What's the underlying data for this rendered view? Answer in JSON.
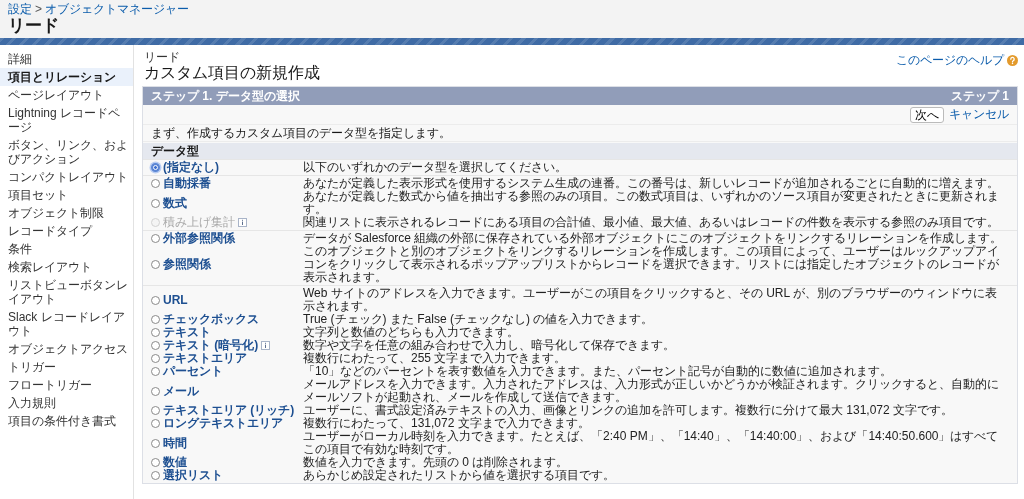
{
  "header": {
    "breadcrumb": [
      "設定",
      "オブジェクトマネージャー"
    ],
    "separator": ">",
    "title": "リード"
  },
  "sidebar": {
    "items": [
      {
        "label": "詳細",
        "selected": false
      },
      {
        "label": "項目とリレーション",
        "selected": true
      },
      {
        "label": "ページレイアウト",
        "selected": false
      },
      {
        "label": "Lightning レコードページ",
        "selected": false
      },
      {
        "label": "ボタン、リンク、およびアクション",
        "selected": false
      },
      {
        "label": "コンパクトレイアウト",
        "selected": false
      },
      {
        "label": "項目セット",
        "selected": false
      },
      {
        "label": "オブジェクト制限",
        "selected": false
      },
      {
        "label": "レコードタイプ",
        "selected": false
      },
      {
        "label": "条件",
        "selected": false
      },
      {
        "label": "検索レイアウト",
        "selected": false
      },
      {
        "label": "リストビューボタンレイアウト",
        "selected": false
      },
      {
        "label": "Slack レコードレイアウト",
        "selected": false
      },
      {
        "label": "オブジェクトアクセス",
        "selected": false
      },
      {
        "label": "トリガー",
        "selected": false
      },
      {
        "label": "フロートリガー",
        "selected": false
      },
      {
        "label": "入力規則",
        "selected": false
      },
      {
        "label": "項目の条件付き書式",
        "selected": false
      }
    ]
  },
  "page": {
    "object": "リード",
    "title": "カスタム項目の新規作成",
    "help_link": "このページのヘルプ"
  },
  "step": {
    "title": "ステップ 1. データ型の選択",
    "counter": "ステップ 1",
    "next_button": "次へ",
    "cancel_link": "キャンセル",
    "intro": "まず、作成するカスタム項目のデータ型を指定します。",
    "section": "データ型",
    "groups": [
      {
        "options": [
          {
            "label": "(指定なし)",
            "selected": true,
            "disabled": false,
            "info": false,
            "description": "以下のいずれかのデータ型を選択してください。"
          }
        ]
      },
      {
        "options": [
          {
            "label": "自動採番",
            "selected": false,
            "disabled": false,
            "info": false,
            "description": "あなたが定義した表示形式を使用するシステム生成の連番。この番号は、新しいレコードが追加されるごとに自動的に増えます。"
          },
          {
            "label": "数式",
            "selected": false,
            "disabled": false,
            "info": false,
            "description": "あなたが定義した数式から値を抽出する参照のみの項目。この数式項目は、いずれかのソース項目が変更されたときに更新されます。"
          },
          {
            "label": "積み上げ集計",
            "selected": false,
            "disabled": true,
            "info": true,
            "description": "関連リストに表示されるレコードにある項目の合計値、最小値、最大値、あるいはレコードの件数を表示する参照のみ項目です。"
          }
        ]
      },
      {
        "options": [
          {
            "label": "外部参照関係",
            "selected": false,
            "disabled": false,
            "info": false,
            "description": "データが Salesforce 組織の外部に保存されている外部オブジェクトにこのオブジェクトをリンクするリレーションを作成します。"
          },
          {
            "label": "参照関係",
            "selected": false,
            "disabled": false,
            "info": false,
            "description": "このオブジェクトと別のオブジェクトをリンクするリレーションを作成します。この項目によって、ユーザーはルックアップアイコンをクリックして表示されるポップアップリストからレコードを選択できます。リストには指定したオブジェクトのレコードが表示されます。"
          }
        ]
      },
      {
        "options": [
          {
            "label": "URL",
            "selected": false,
            "disabled": false,
            "info": false,
            "description": "Web サイトのアドレスを入力できます。ユーザーがこの項目をクリックすると、その URL が、別のブラウザーのウィンドウに表示されます。"
          },
          {
            "label": "チェックボックス",
            "selected": false,
            "disabled": false,
            "info": false,
            "description": "True (チェック) また False (チェックなし) の値を入力できます。"
          },
          {
            "label": "テキスト",
            "selected": false,
            "disabled": false,
            "info": false,
            "description": "文字列と数値のどちらも入力できます。"
          },
          {
            "label": "テキスト (暗号化)",
            "selected": false,
            "disabled": false,
            "info": true,
            "description": "数字や文字を任意の組み合わせで入力し、暗号化して保存できます。"
          },
          {
            "label": "テキストエリア",
            "selected": false,
            "disabled": false,
            "info": false,
            "description": "複数行にわたって、255 文字まで入力できます。"
          },
          {
            "label": "パーセント",
            "selected": false,
            "disabled": false,
            "info": false,
            "description": "「10」などのパーセントを表す数値を入力できます。また、パーセント記号が自動的に数値に追加されます。"
          },
          {
            "label": "メール",
            "selected": false,
            "disabled": false,
            "info": false,
            "description": "メールアドレスを入力できます。入力されたアドレスは、入力形式が正しいかどうかが検証されます。クリックすると、自動的にメールソフトが起動され、メールを作成して送信できます。"
          },
          {
            "label": "テキストエリア (リッチ)",
            "selected": false,
            "disabled": false,
            "info": false,
            "description": "ユーザーに、書式設定済みテキストの入力、画像とリンクの追加を許可します。複数行に分けて最大 131,072 文字です。"
          },
          {
            "label": "ロングテキストエリア",
            "selected": false,
            "disabled": false,
            "info": false,
            "description": "複数行にわたって、131,072 文字まで入力できます。"
          },
          {
            "label": "時間",
            "selected": false,
            "disabled": false,
            "info": false,
            "description": "ユーザーがローカル時刻を入力できます。たとえば、「2:40 PM」、「14:40」、「14:40:00」、および「14:40:50.600」はすべてこの項目で有効な時刻です。"
          },
          {
            "label": "数値",
            "selected": false,
            "disabled": false,
            "info": false,
            "description": "数値を入力できます。先頭の 0 は削除されます。"
          },
          {
            "label": "選択リスト",
            "selected": false,
            "disabled": false,
            "info": false,
            "description": "あらかじめ設定されたリストから値を選択する項目です。"
          }
        ]
      }
    ]
  }
}
